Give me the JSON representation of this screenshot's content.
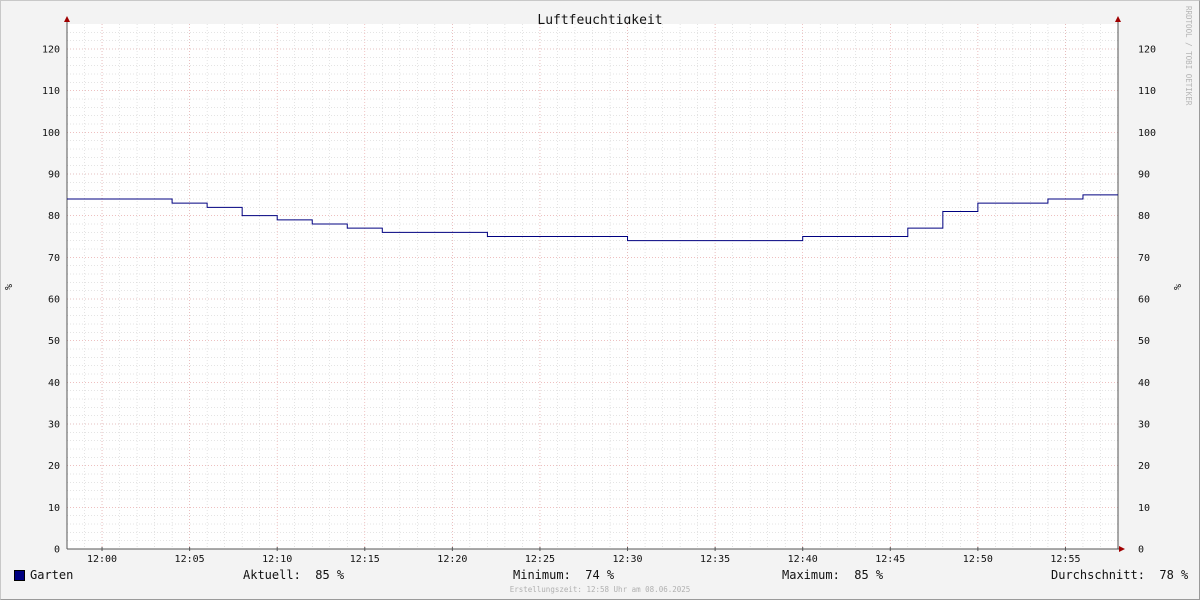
{
  "chart_data": {
    "type": "line",
    "title": "Luftfeuchtigkeit",
    "ylabel": "%",
    "ylabel_right": "%",
    "ylim": [
      0,
      126
    ],
    "yticks": [
      0,
      10,
      20,
      30,
      40,
      50,
      60,
      70,
      80,
      90,
      100,
      110,
      120
    ],
    "xlim": [
      "11:58",
      "12:58"
    ],
    "xticks": [
      "12:00",
      "12:05",
      "12:10",
      "12:15",
      "12:20",
      "12:25",
      "12:30",
      "12:35",
      "12:40",
      "12:45",
      "12:50",
      "12:55"
    ],
    "grid": true,
    "series": [
      {
        "name": "Garten",
        "color": "#000080",
        "step": true,
        "points": [
          [
            "11:58",
            84
          ],
          [
            "12:04",
            83
          ],
          [
            "12:06",
            82
          ],
          [
            "12:08",
            80
          ],
          [
            "12:10",
            79
          ],
          [
            "12:12",
            78
          ],
          [
            "12:14",
            77
          ],
          [
            "12:16",
            76
          ],
          [
            "12:22",
            75
          ],
          [
            "12:30",
            74
          ],
          [
            "12:40",
            75
          ],
          [
            "12:46",
            77
          ],
          [
            "12:48",
            81
          ],
          [
            "12:50",
            83
          ],
          [
            "12:54",
            84
          ],
          [
            "12:56",
            85
          ],
          [
            "12:58",
            85
          ]
        ]
      }
    ]
  },
  "legend": {
    "series_name": "Garten",
    "series_color": "#000080",
    "current": "Aktuell:  85 %",
    "minimum": "Minimum:  74 %",
    "maximum": "Maximum:  85 %",
    "average": "Durchschnitt:  78 %"
  },
  "footer": "Erstellungszeit: 12:58 Uhr am 08.06.2025",
  "watermark": "RRDTOOL / TOBI OETIKER",
  "colors": {
    "background": "#f3f3f3",
    "canvas": "#ffffff",
    "major_grid": "#e8a0a0",
    "minor_grid": "#c8c8c8",
    "axis": "#555555",
    "arrow": "#a00000"
  }
}
